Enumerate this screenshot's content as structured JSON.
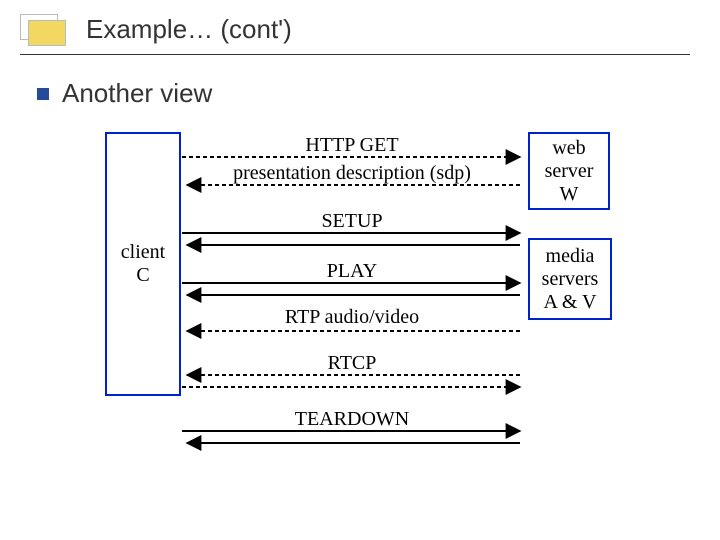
{
  "title": "Example… (cont')",
  "section": "Another view",
  "client": "client\nC",
  "web": "web\nserver\nW",
  "media": "media\nservers\nA & V",
  "msgs": {
    "http_get": "HTTP GET",
    "sdp": "presentation description (sdp)",
    "setup": "SETUP",
    "play": "PLAY",
    "rtp": "RTP audio/video",
    "rtcp": "RTCP",
    "teardown": "TEARDOWN"
  }
}
